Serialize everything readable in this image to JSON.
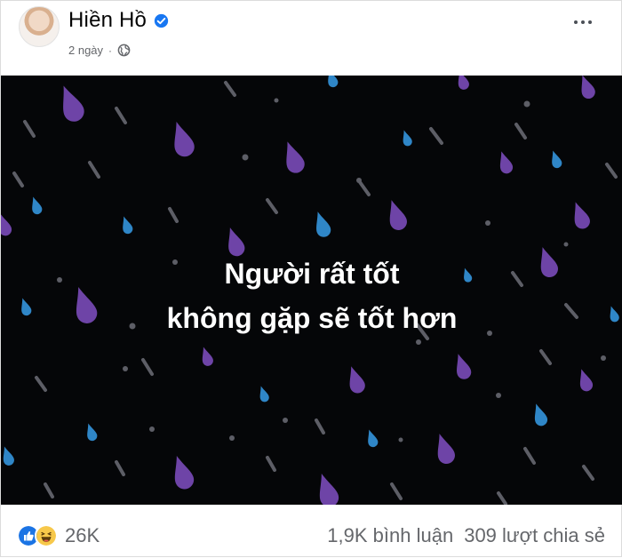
{
  "post": {
    "author": "Hiền Hồ",
    "time": "2 ngày",
    "separator": "·",
    "text_line1": "Người rất tốt",
    "text_line2": "không gặp sẽ tốt hơn",
    "background_color": "#050608"
  },
  "footer": {
    "reaction_count": "26K",
    "comments": "1,9K bình luận",
    "shares": "309 lượt chia sẻ"
  },
  "icons": {
    "verified": "verified-badge-icon",
    "audience": "globe-icon",
    "more": "more-options-icon",
    "reactions": [
      "like-icon",
      "haha-icon"
    ]
  },
  "colors": {
    "verified": "#1877f2",
    "drop_purple": "#6e44a7",
    "drop_blue": "#2f86c7",
    "drop_gray": "#5d5e66"
  }
}
